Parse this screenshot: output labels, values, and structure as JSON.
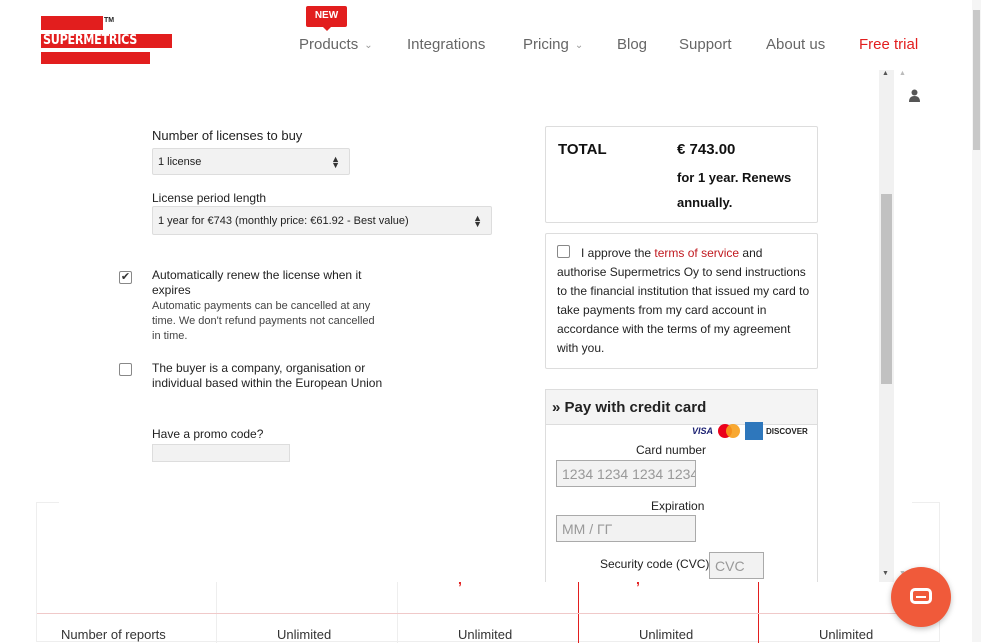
{
  "brand": {
    "logo_text": "SUPERMETRICS",
    "tm": "TM",
    "accent": "#e21e1e"
  },
  "nav": {
    "new_badge": "NEW",
    "products": "Products",
    "integrations": "Integrations",
    "pricing": "Pricing",
    "blog": "Blog",
    "support": "Support",
    "about": "About us",
    "free_trial": "Free trial",
    "chevron": "⌄"
  },
  "form": {
    "licenses_label": "Number of licenses to buy",
    "licenses_value": "1 license",
    "period_label": "License period length",
    "period_value": "1 year for €743 (monthly price: €61.92 - Best value)",
    "auto_renew_label": "Automatically renew the license when it expires",
    "auto_renew_checked": true,
    "auto_renew_note": "Automatic payments can be cancelled at any time. We don't refund payments not cancelled in time.",
    "eu_company_label": "The buyer is a company, organisation or individual based within the European Union",
    "eu_company_checked": false,
    "promo_label": "Have a promo code?",
    "promo_value": ""
  },
  "total": {
    "label": "TOTAL",
    "amount": "€ 743.00",
    "note": "for 1 year. Renews annually."
  },
  "approve": {
    "checked": false,
    "text_before": "I approve the ",
    "link": "terms of service",
    "text_after": " and authorise Supermetrics Oy to send instructions to the financial institution that issued my card to take payments from my card account in accordance with the terms of my agreement with you."
  },
  "payment": {
    "header": "» Pay with credit card",
    "card_brands": [
      "VISA",
      "mastercard-icon",
      "amex-icon",
      "DISCOVER"
    ],
    "card_number_label": "Card number",
    "card_number_placeholder": "1234 1234 1234 1234",
    "expiration_label": "Expiration",
    "expiration_placeholder": "MM / ГГ",
    "cvc_label": "Security code (CVC)",
    "cvc_placeholder": "CVC"
  },
  "background_table": {
    "row_label": "Number of reports",
    "values": [
      "Unlimited",
      "Unlimited",
      "Unlimited",
      "Unlimited"
    ]
  }
}
